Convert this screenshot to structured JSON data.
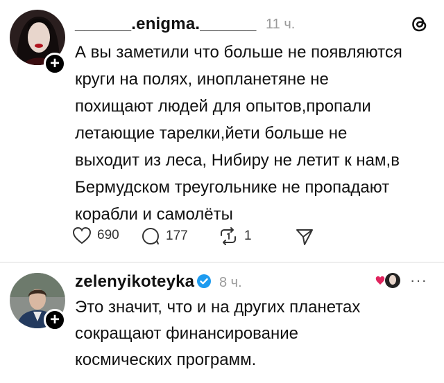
{
  "post1": {
    "author": "______.enigma.______",
    "time": "11 ч.",
    "text": "А вы заметили что больше не появляются\nкруги на полях, инопланетяне не\nпохищают людей для опытов,пропали\nлетающие тарелки,йети больше не\nвыходит из леса, Нибиру не летит к нам,в\nБермудском треугольнике не пропадают\nкорабли и самолёты",
    "likes": "690",
    "replies": "177",
    "reposts": "1"
  },
  "post2": {
    "author": "zelenyikoteyka",
    "time": "8 ч.",
    "more": "···",
    "text": "Это значит, что и на других планетах\nсокращают финансирование\nкосмических программ."
  },
  "colors": {
    "verified": "#1d9bf0",
    "liked": "#e0245e"
  },
  "icons": [
    "threads-logo-icon",
    "heart-icon",
    "comment-icon",
    "repost-icon",
    "share-icon",
    "more-icon",
    "liked-by-author-icon"
  ]
}
